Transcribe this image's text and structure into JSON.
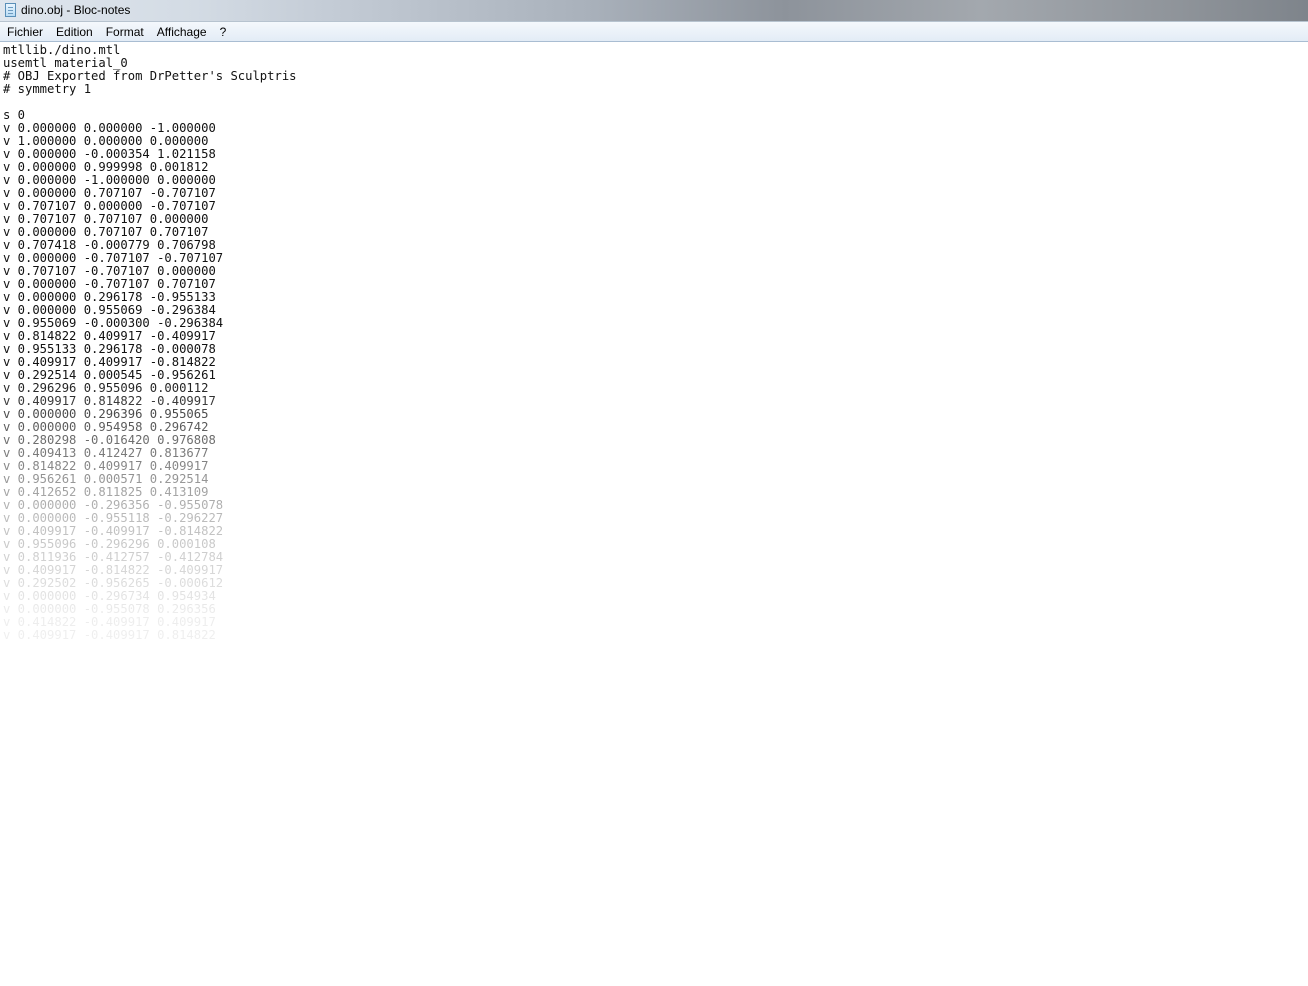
{
  "window": {
    "title": "dino.obj - Bloc-notes",
    "icon": "notepad-icon"
  },
  "menu": {
    "items": [
      "Fichier",
      "Edition",
      "Format",
      "Affichage",
      "?"
    ]
  },
  "editor": {
    "lines": [
      "mtllib./dino.mtl",
      "usemtl material_0",
      "# OBJ Exported from DrPetter's Sculptris",
      "# symmetry 1",
      "",
      "s 0",
      "v 0.000000 0.000000 -1.000000",
      "v 1.000000 0.000000 0.000000",
      "v 0.000000 -0.000354 1.021158",
      "v 0.000000 0.999998 0.001812",
      "v 0.000000 -1.000000 0.000000",
      "v 0.000000 0.707107 -0.707107",
      "v 0.707107 0.000000 -0.707107",
      "v 0.707107 0.707107 0.000000",
      "v 0.000000 0.707107 0.707107",
      "v 0.707418 -0.000779 0.706798",
      "v 0.000000 -0.707107 -0.707107",
      "v 0.707107 -0.707107 0.000000",
      "v 0.000000 -0.707107 0.707107",
      "v 0.000000 0.296178 -0.955133",
      "v 0.000000 0.955069 -0.296384",
      "v 0.955069 -0.000300 -0.296384",
      "v 0.814822 0.409917 -0.409917",
      "v 0.955133 0.296178 -0.000078",
      "v 0.409917 0.409917 -0.814822",
      "v 0.292514 0.000545 -0.956261",
      "v 0.296296 0.955096 0.000112",
      "v 0.409917 0.814822 -0.409917",
      "v 0.000000 0.296396 0.955065",
      "v 0.000000 0.954958 0.296742",
      "v 0.280298 -0.016420 0.976808",
      "v 0.409413 0.412427 0.813677",
      "v 0.814822 0.409917 0.409917",
      "v 0.956261 0.000571 0.292514",
      "v 0.412652 0.811825 0.413109",
      "v 0.000000 -0.296356 -0.955078",
      "v 0.000000 -0.955118 -0.296227",
      "v 0.409917 -0.409917 -0.814822",
      "v 0.955096 -0.296296 0.000108",
      "v 0.811936 -0.412757 -0.412784",
      "v 0.409917 -0.814822 -0.409917",
      "v 0.292502 -0.956265 -0.000612",
      "v 0.000000 -0.296734 0.954934",
      "v 0.000000 -0.955078 0.296356",
      "v 0.414822 -0.409917 0.409917",
      "v 0.409917 -0.409917 0.814822"
    ]
  },
  "colors": {
    "text": "#111111",
    "background": "#ffffff",
    "menubar": "#e8eef6"
  }
}
